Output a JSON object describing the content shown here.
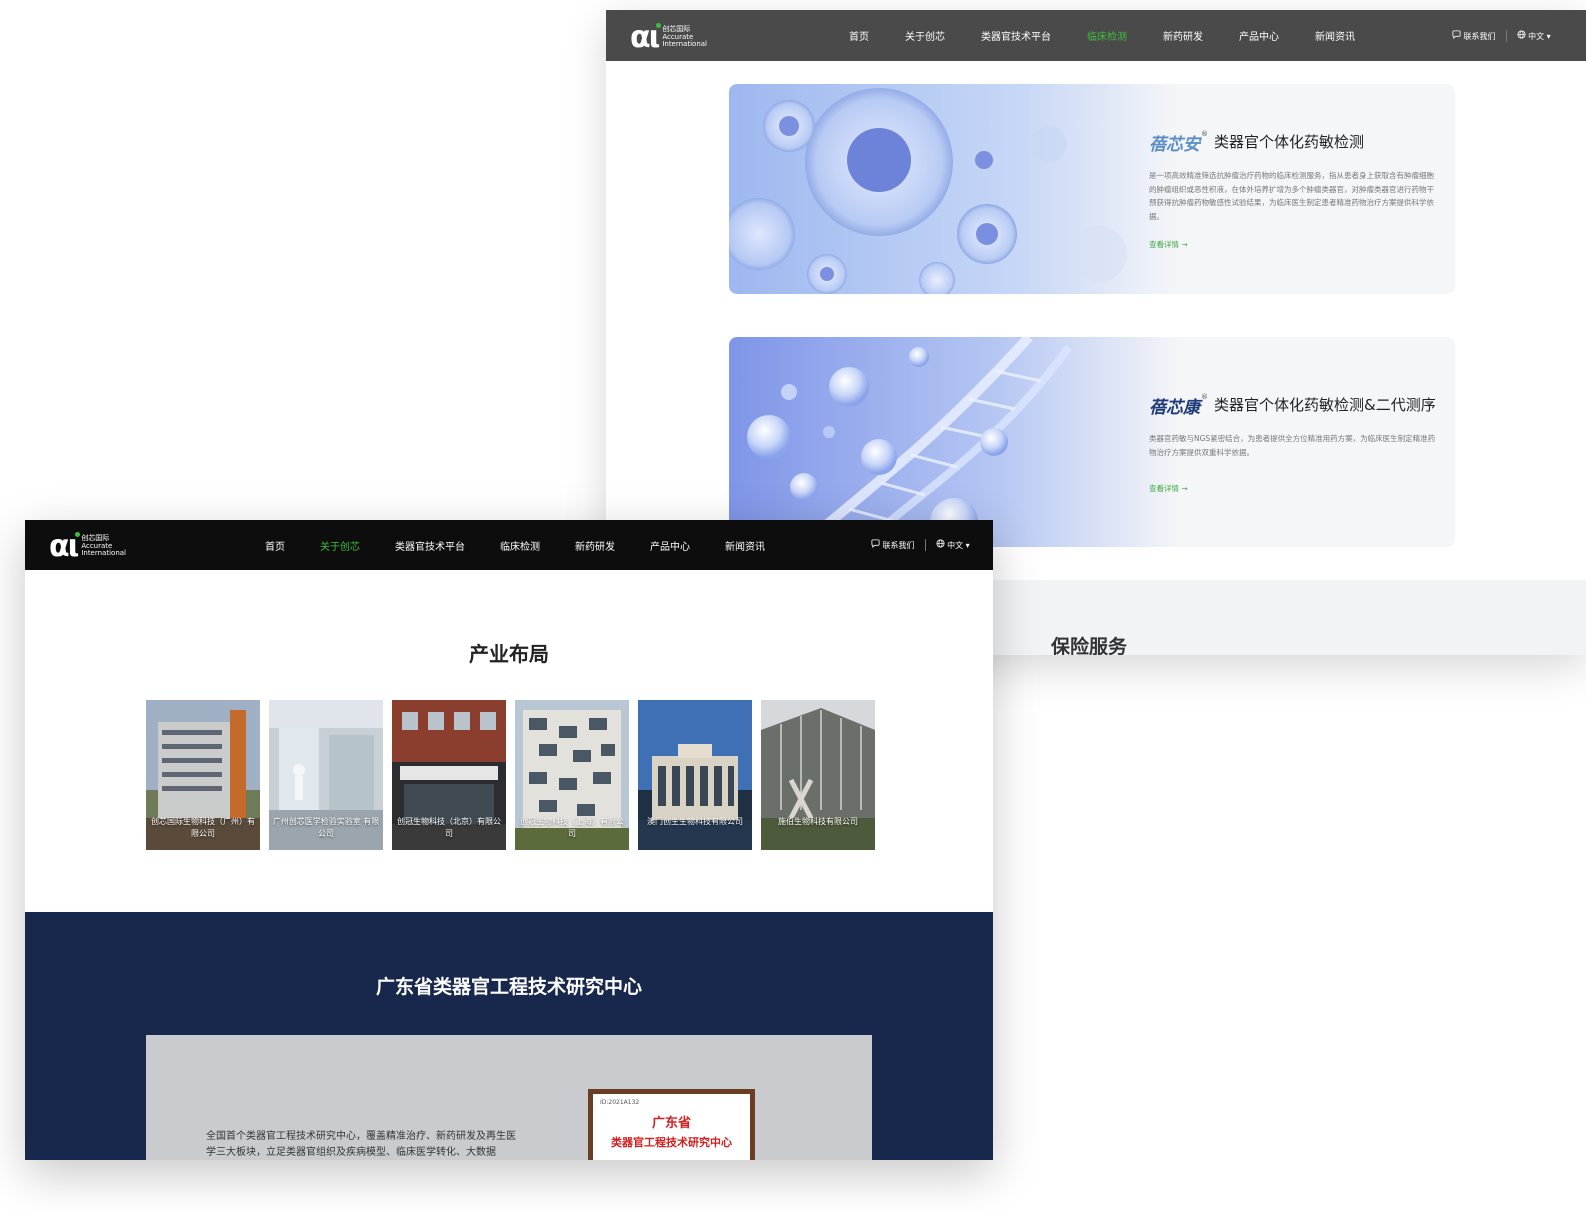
{
  "back_window": {
    "nav": {
      "logo_cn": "创芯国际",
      "logo_en1": "Accurate",
      "logo_en2": "International",
      "items": [
        "首页",
        "关于创芯",
        "类器官技术平台",
        "临床检测",
        "新药研发",
        "产品中心",
        "新闻资讯"
      ],
      "active_index": 3,
      "contact": "联系我们",
      "language": "中文"
    },
    "cards": [
      {
        "brand": "蓓芯安",
        "reg": "®",
        "title": "类器官个体化药敏检测",
        "description": "是一项高效精准筛选抗肿瘤治疗药物的临床检测服务，指从患者身上获取含有肿瘤细胞的肿瘤组织或恶性积液，在体外培养扩增为多个肿瘤类器官，对肿瘤类器官进行药物干预获得抗肿瘤药物敏感性试验结果，为临床医生制定患者精准药物治疗方案提供科学依据。",
        "link": "查看详情 →"
      },
      {
        "brand": "蓓芯康",
        "reg": "®",
        "title": "类器官个体化药敏检测&二代测序",
        "description": "类器官药敏与NGS紧密结合，为患者提供全方位精准用药方案，为临床医生制定精准药物治疗方案提供双重科学依据。",
        "link": "查看详情 →"
      }
    ],
    "section_title": "保险服务"
  },
  "front_window": {
    "nav": {
      "logo_cn": "创芯国际",
      "logo_en1": "Accurate",
      "logo_en2": "International",
      "items": [
        "首页",
        "关于创芯",
        "类器官技术平台",
        "临床检测",
        "新药研发",
        "产品中心",
        "新闻资讯"
      ],
      "active_index": 1,
      "contact": "联系我们",
      "language": "中文"
    },
    "industry": {
      "title": "产业布局",
      "tiles": [
        "创芯国际生物科技（广州）有限公司",
        "广州创芯医学检验实验室 有限公司",
        "创冠生物科技（北京）有限公司",
        "创冠生物科技（上海）有限公司",
        "澳门创生生物科技有限公司",
        "施伯生物科技有限公司"
      ]
    },
    "center": {
      "title": "广东省类器官工程技术研究中心",
      "description": "全国首个类器官工程技术研究中心，覆盖精准治疗、新药研发及再生医学三大板块，立足类器官组织及疾病模型、临床医学转化、大数据",
      "plaque_id": "ID:2021A132",
      "plaque_line1": "广东省",
      "plaque_line2": "类器官工程技术研究中心"
    }
  },
  "colors": {
    "accent_green": "#3fbf3f",
    "back_nav_bg": "#4a4a4a",
    "front_nav_bg": "#0d0d0d",
    "dark_section_bg": "#17284c",
    "plaque_red": "#d02020"
  },
  "icons": [
    "logo-mark",
    "chat-icon",
    "globe-icon",
    "chevron-down-icon",
    "arrow-right-icon"
  ]
}
